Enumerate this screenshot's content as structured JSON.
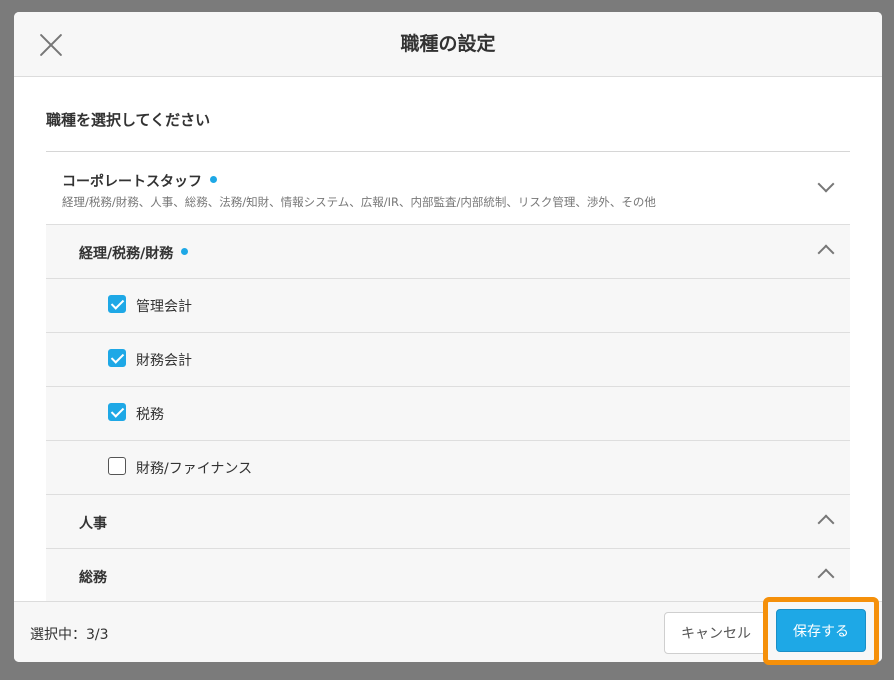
{
  "dialog": {
    "title": "職種の設定",
    "instruction": "職種を選択してください"
  },
  "categories": [
    {
      "name": "コーポレートスタッフ",
      "description": "経理/税務/財務、人事、総務、法務/知財、情報システム、広報/IR、内部監査/内部統制、リスク管理、渉外、その他"
    }
  ],
  "subcategories": [
    {
      "name": "経理/税務/財務",
      "items": [
        {
          "label": "管理会計",
          "checked": true
        },
        {
          "label": "財務会計",
          "checked": true
        },
        {
          "label": "税務",
          "checked": true
        },
        {
          "label": "財務/ファイナンス",
          "checked": false
        }
      ]
    },
    {
      "name": "人事"
    },
    {
      "name": "総務"
    }
  ],
  "footer": {
    "selected_count": "選択中：3/3",
    "cancel_label": "キャンセル",
    "save_label": "保存する"
  },
  "colors": {
    "accent": "#1ea8e6",
    "highlight": "#f5900a"
  }
}
